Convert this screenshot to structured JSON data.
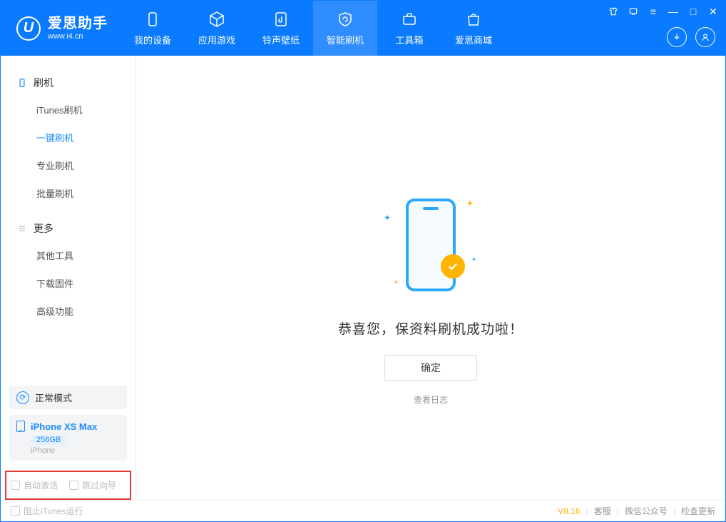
{
  "logo": {
    "title": "爱思助手",
    "sub": "www.i4.cn",
    "badge": "U"
  },
  "nav": [
    {
      "label": "我的设备"
    },
    {
      "label": "应用游戏"
    },
    {
      "label": "铃声壁纸"
    },
    {
      "label": "智能刷机"
    },
    {
      "label": "工具箱"
    },
    {
      "label": "爱思商城"
    }
  ],
  "sidebar": {
    "section1": {
      "title": "刷机",
      "items": [
        {
          "label": "iTunes刷机"
        },
        {
          "label": "一键刷机"
        },
        {
          "label": "专业刷机"
        },
        {
          "label": "批量刷机"
        }
      ]
    },
    "section2": {
      "title": "更多",
      "items": [
        {
          "label": "其他工具"
        },
        {
          "label": "下载固件"
        },
        {
          "label": "高级功能"
        }
      ]
    },
    "mode": "正常模式",
    "device": {
      "name": "iPhone XS Max",
      "storage": "256GB",
      "type": "iPhone"
    },
    "opts": {
      "a": "自动激活",
      "b": "跳过向导"
    }
  },
  "main": {
    "success": "恭喜您，保资料刷机成功啦！",
    "ok": "确定",
    "log": "查看日志"
  },
  "footer": {
    "block": "阻止iTunes运行",
    "version": "V8.16",
    "links": [
      "客服",
      "微信公众号",
      "检查更新"
    ]
  }
}
